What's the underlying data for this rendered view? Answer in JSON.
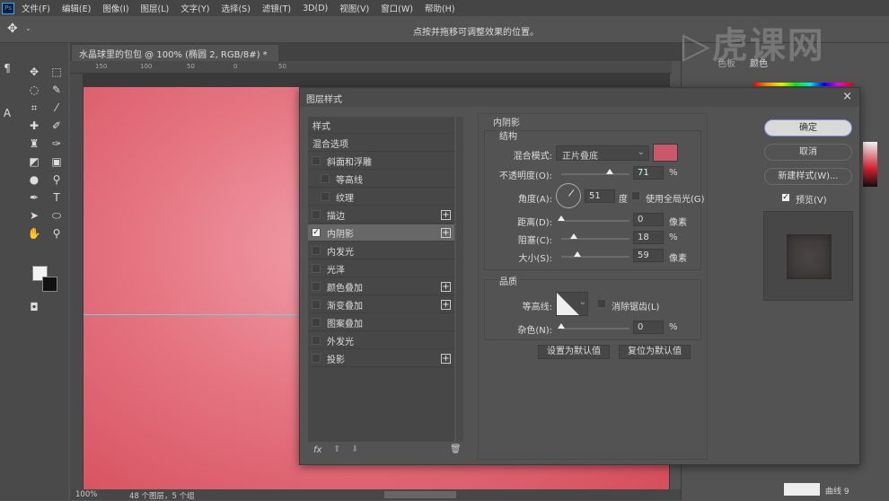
{
  "app": {
    "logo": "Ps"
  },
  "menu": [
    "文件(F)",
    "编辑(E)",
    "图像(I)",
    "图层(L)",
    "文字(Y)",
    "选择(S)",
    "滤镜(T)",
    "3D(D)",
    "视图(V)",
    "窗口(W)",
    "帮助(H)"
  ],
  "options_bar": {
    "hint": "点按并拖移可调整效果的位置。"
  },
  "document_tab": {
    "title": "水晶球里的包包 @ 100% (椭圆 2, RGB/8#) *",
    "close": "×"
  },
  "ruler": {
    "ticks": [
      "150",
      "100",
      "50",
      "0",
      "50"
    ]
  },
  "status": {
    "zoom": "100%",
    "info": "48 个图层，5 个组"
  },
  "right_panel": {
    "tabs": [
      "色板",
      "颜色"
    ],
    "layer_name": "曲线 9"
  },
  "watermark": "虎课网",
  "dialog": {
    "title": "图层样式",
    "close": "×",
    "styles_header": "样式",
    "blend_options": "混合选项",
    "styles": [
      {
        "label": "斜面和浮雕",
        "checked": false,
        "plus": false,
        "indent": false
      },
      {
        "label": "等高线",
        "checked": false,
        "plus": false,
        "indent": true
      },
      {
        "label": "纹理",
        "checked": false,
        "plus": false,
        "indent": true
      },
      {
        "label": "描边",
        "checked": false,
        "plus": true,
        "indent": false
      },
      {
        "label": "内阴影",
        "checked": true,
        "plus": true,
        "indent": false,
        "selected": true
      },
      {
        "label": "内发光",
        "checked": false,
        "plus": false,
        "indent": false
      },
      {
        "label": "光泽",
        "checked": false,
        "plus": false,
        "indent": false
      },
      {
        "label": "颜色叠加",
        "checked": false,
        "plus": true,
        "indent": false
      },
      {
        "label": "渐变叠加",
        "checked": false,
        "plus": true,
        "indent": false
      },
      {
        "label": "图案叠加",
        "checked": false,
        "plus": false,
        "indent": false
      },
      {
        "label": "外发光",
        "checked": false,
        "plus": false,
        "indent": false
      },
      {
        "label": "投影",
        "checked": false,
        "plus": true,
        "indent": false
      }
    ],
    "footer": {
      "fx": "fx"
    },
    "inner_shadow": {
      "title": "内阴影",
      "structure": "结构",
      "blend_mode_label": "混合模式:",
      "blend_mode": "正片叠底",
      "color": "#c9596a",
      "opacity_label": "不透明度(O):",
      "opacity": "71",
      "opacity_unit": "%",
      "angle_label": "角度(A):",
      "angle": "51",
      "angle_unit": "度",
      "global_light_label": "使用全局光(G)",
      "global_light": false,
      "distance_label": "距离(D):",
      "distance": "0",
      "distance_unit": "像素",
      "choke_label": "阻塞(C):",
      "choke": "18",
      "choke_unit": "%",
      "size_label": "大小(S):",
      "size": "59",
      "size_unit": "像素",
      "quality": "品质",
      "contour_label": "等高线:",
      "antialias_label": "消除锯齿(L)",
      "antialias": false,
      "noise_label": "杂色(N):",
      "noise": "0",
      "noise_unit": "%",
      "set_default": "设置为默认值",
      "reset_default": "复位为默认值"
    },
    "buttons": {
      "ok": "确定",
      "cancel": "取消",
      "new_style": "新建样式(W)...",
      "preview_label": "预览(V)",
      "preview": true
    }
  }
}
